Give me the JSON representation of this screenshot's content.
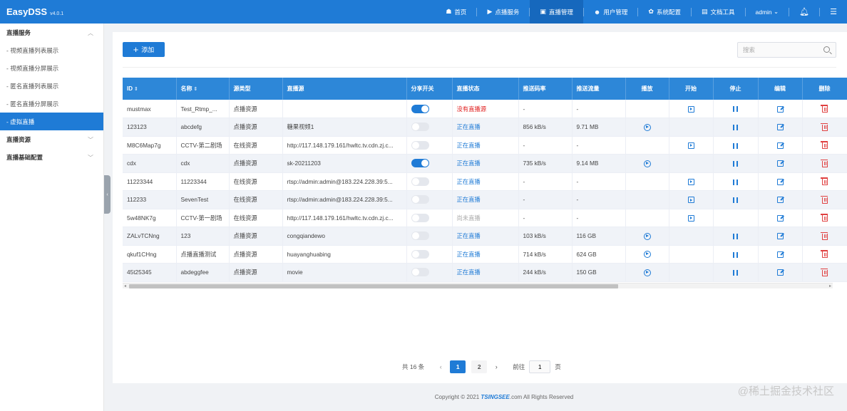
{
  "brand": {
    "name": "EasyDSS",
    "version": "v4.0.1"
  },
  "topnav": [
    {
      "icon": "☗",
      "label": "首页"
    },
    {
      "icon": "▶",
      "label": "点播服务"
    },
    {
      "icon": "▣",
      "label": "直播管理"
    },
    {
      "icon": "☻",
      "label": "用户管理"
    },
    {
      "icon": "✿",
      "label": "系统配置"
    },
    {
      "icon": "▤",
      "label": "文档工具"
    }
  ],
  "user": {
    "name": "admin",
    "caret": "⌄"
  },
  "sidebar": {
    "group1": {
      "label": "直播服务",
      "chev": "︿"
    },
    "items": [
      {
        "label": "- 视频直播列表展示"
      },
      {
        "label": "- 视频直播分屏展示"
      },
      {
        "label": "- 匿名直播列表展示"
      },
      {
        "label": "- 匿名直播分屏展示"
      },
      {
        "label": "- 虚拟直播"
      }
    ],
    "group2": {
      "label": "直播资源",
      "chev": "﹀"
    },
    "group3": {
      "label": "直播基础配置",
      "chev": "﹀"
    }
  },
  "toolbar": {
    "add_label": "添加",
    "search_placeholder": "搜索"
  },
  "table": {
    "headers": [
      "ID",
      "名称",
      "源类型",
      "直播源",
      "分享开关",
      "直播状态",
      "推送码率",
      "推送流量",
      "播放",
      "开始",
      "停止",
      "编辑",
      "删除"
    ],
    "sort_icon": "⇕",
    "rows": [
      {
        "id": "mustmax",
        "name": "Test_Rtmp_...",
        "type": "点播资源",
        "src": "",
        "share": true,
        "status": "没有直播源",
        "status_kind": "red",
        "bitrate": "-",
        "traffic": "-",
        "play": false,
        "start": true,
        "stop": true
      },
      {
        "id": "123123",
        "name": "abcdefg",
        "type": "点播资源",
        "src": "糖果视频1",
        "share": false,
        "status": "正在直播",
        "status_kind": "blue",
        "bitrate": "856 kB/s",
        "traffic": "9.71 MB",
        "play": true,
        "start": false,
        "stop": true
      },
      {
        "id": "M8C6Map7g",
        "name": "CCTV-第二剧场",
        "type": "在线资源",
        "src": "http://117.148.179.161/hwltc.tv.cdn.zj.c...",
        "share": false,
        "status": "正在直播",
        "status_kind": "blue",
        "bitrate": "-",
        "traffic": "-",
        "play": false,
        "start": true,
        "stop": true
      },
      {
        "id": "cdx",
        "name": "cdx",
        "type": "点播资源",
        "src": "sk-20211203",
        "share": true,
        "status": "正在直播",
        "status_kind": "blue",
        "bitrate": "735 kB/s",
        "traffic": "9.14 MB",
        "play": true,
        "start": false,
        "stop": true
      },
      {
        "id": "11223344",
        "name": "11223344",
        "type": "在线资源",
        "src": "rtsp://admin:admin@183.224.228.39:5...",
        "share": false,
        "status": "正在直播",
        "status_kind": "blue",
        "bitrate": "-",
        "traffic": "-",
        "play": false,
        "start": true,
        "stop": true
      },
      {
        "id": "112233",
        "name": "SevenTest",
        "type": "在线资源",
        "src": "rtsp://admin:admin@183.224.228.39:5...",
        "share": false,
        "status": "正在直播",
        "status_kind": "blue",
        "bitrate": "-",
        "traffic": "-",
        "play": false,
        "start": true,
        "stop": true
      },
      {
        "id": "5w48NK7g",
        "name": "CCTV-第一剧场",
        "type": "在线资源",
        "src": "http://117.148.179.161/hwltc.tv.cdn.zj.c...",
        "share": false,
        "status": "尚未直播",
        "status_kind": "gray",
        "bitrate": "-",
        "traffic": "-",
        "play": false,
        "start": true,
        "stop": false
      },
      {
        "id": "ZALvTCNng",
        "name": "123",
        "type": "点播资源",
        "src": "congqiandewo",
        "share": false,
        "status": "正在直播",
        "status_kind": "blue",
        "bitrate": "103 kB/s",
        "traffic": "116 GB",
        "play": true,
        "start": false,
        "stop": true
      },
      {
        "id": "qkuf1CHng",
        "name": "点播直播测试",
        "type": "点播资源",
        "src": "huayanghuabing",
        "share": false,
        "status": "正在直播",
        "status_kind": "blue",
        "bitrate": "714 kB/s",
        "traffic": "624 GB",
        "play": true,
        "start": false,
        "stop": true
      },
      {
        "id": "45t25345",
        "name": "abdeggfee",
        "type": "点播资源",
        "src": "movie",
        "share": false,
        "status": "正在直播",
        "status_kind": "blue",
        "bitrate": "244 kB/s",
        "traffic": "150 GB",
        "play": true,
        "start": false,
        "stop": true
      }
    ]
  },
  "pagination": {
    "total": "共 16 条",
    "prev": "‹",
    "next": "›",
    "pages": [
      "1",
      "2"
    ],
    "current": "1",
    "goto_prefix": "前往",
    "goto_value": "1",
    "goto_suffix": "页"
  },
  "footer": {
    "prefix": "Copyright © 2021",
    "logo": "TSINGSEE",
    "suffix": ".com All Rights Reserved"
  },
  "watermark": "@稀土掘金技术社区",
  "colors": {
    "primary": "#1f7bd6",
    "header": "#2d87d8",
    "danger": "#e04040"
  }
}
